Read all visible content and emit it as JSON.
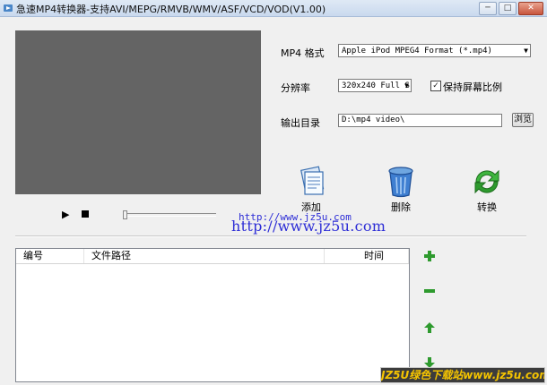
{
  "window": {
    "title": "急速MP4转换器-支持AVI/MEPG/RMVB/WMV/ASF/VCD/VOD(V1.00)",
    "min_label": "─",
    "max_label": "□",
    "close_label": "✕"
  },
  "player": {
    "play_glyph": "▶"
  },
  "settings": {
    "format_label": "MP4 格式",
    "format_value": "Apple iPod MPEG4 Format (*.mp4)",
    "resolution_label": "分辨率",
    "resolution_value": "320x240 Full S",
    "keep_ratio_label": "保持屏幕比例",
    "keep_ratio_checked": true,
    "check_glyph": "✓",
    "output_label": "输出目录",
    "output_value": "D:\\mp4 video\\",
    "browse_label": "浏览"
  },
  "actions": {
    "add_label": "添加",
    "delete_label": "删除",
    "convert_label": "转换"
  },
  "watermark": {
    "small": "http://www.jz5u.com",
    "large": "http://www.jz5u.com",
    "banner": "JZ5U绿色下载站www.jz5u.com"
  },
  "file_list": {
    "columns": [
      "编号",
      "文件路径",
      "时间"
    ],
    "rows": []
  },
  "colors": {
    "video_bg": "#646464",
    "side_button_green": "#2e9a2e",
    "watermark_blue": "#2d2dd6",
    "banner_text": "#f5c400"
  }
}
